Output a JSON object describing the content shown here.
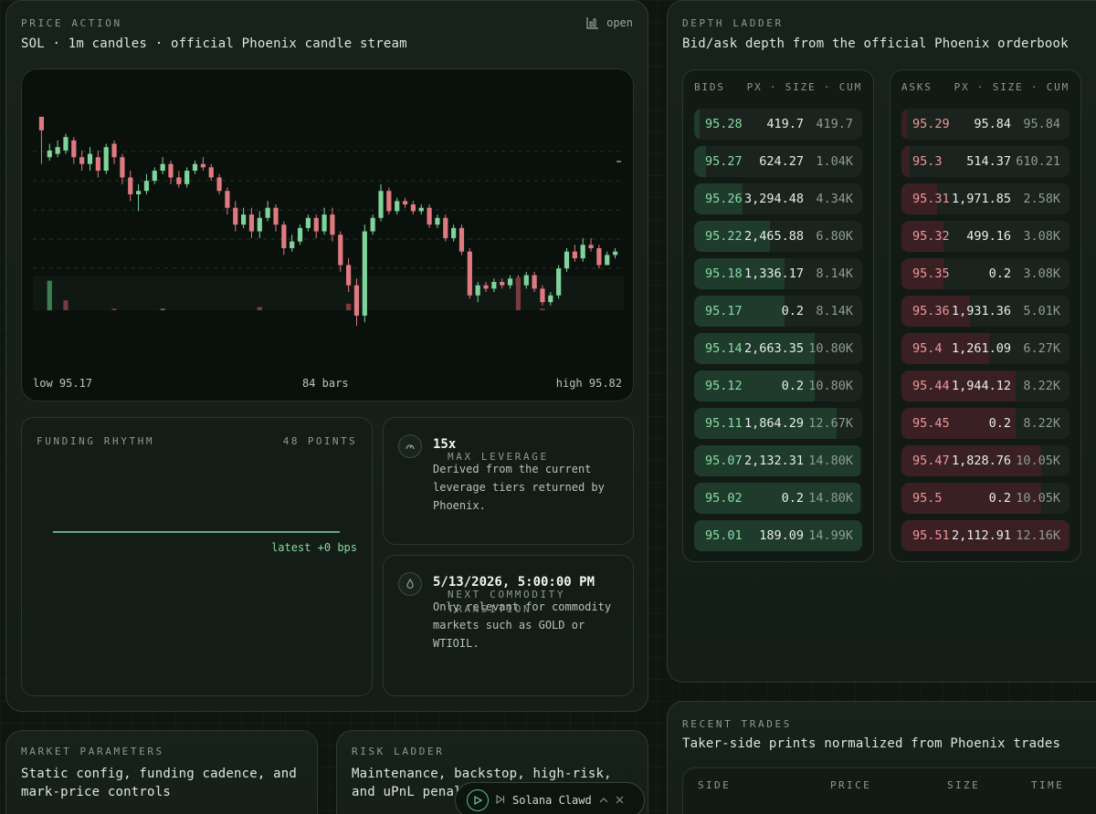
{
  "price_action": {
    "eyebrow": "PRICE ACTION",
    "subtitle": "SOL · 1m candles · official Phoenix candle stream",
    "open_label": "open",
    "low_label": "low 95.17",
    "bars_label": "84 bars",
    "high_label": "high 95.82"
  },
  "chart_data": {
    "type": "candlestick",
    "title": "",
    "ylim": [
      95.17,
      95.82
    ],
    "bars": 84,
    "colors": {
      "up": "#7fd39b",
      "down": "#e07a80",
      "grid": "#24322a"
    },
    "candles": [
      [
        95.82,
        95.78,
        95.82,
        95.68
      ],
      [
        95.7,
        95.72,
        95.74,
        95.69
      ],
      [
        95.71,
        95.73,
        95.75,
        95.7
      ],
      [
        95.72,
        95.76,
        95.77,
        95.71
      ],
      [
        95.75,
        95.7,
        95.76,
        95.68
      ],
      [
        95.7,
        95.68,
        95.72,
        95.66
      ],
      [
        95.68,
        95.71,
        95.73,
        95.66
      ],
      [
        95.7,
        95.66,
        95.72,
        95.64
      ],
      [
        95.66,
        95.73,
        95.74,
        95.65
      ],
      [
        95.74,
        95.7,
        95.75,
        95.68
      ],
      [
        95.7,
        95.64,
        95.71,
        95.62
      ],
      [
        95.64,
        95.59,
        95.66,
        95.57
      ],
      [
        95.59,
        95.6,
        95.62,
        95.54
      ],
      [
        95.6,
        95.63,
        95.65,
        95.59
      ],
      [
        95.63,
        95.66,
        95.67,
        95.62
      ],
      [
        95.66,
        95.68,
        95.7,
        95.65
      ],
      [
        95.68,
        95.64,
        95.69,
        95.62
      ],
      [
        95.64,
        95.62,
        95.66,
        95.61
      ],
      [
        95.62,
        95.66,
        95.67,
        95.61
      ],
      [
        95.66,
        95.68,
        95.69,
        95.65
      ],
      [
        95.68,
        95.67,
        95.7,
        95.66
      ],
      [
        95.67,
        95.64,
        95.68,
        95.63
      ],
      [
        95.64,
        95.6,
        95.65,
        95.59
      ],
      [
        95.6,
        95.55,
        95.61,
        95.53
      ],
      [
        95.55,
        95.5,
        95.57,
        95.48
      ],
      [
        95.5,
        95.53,
        95.55,
        95.49
      ],
      [
        95.53,
        95.48,
        95.55,
        95.46
      ],
      [
        95.48,
        95.52,
        95.54,
        95.46
      ],
      [
        95.52,
        95.55,
        95.57,
        95.51
      ],
      [
        95.55,
        95.5,
        95.56,
        95.48
      ],
      [
        95.5,
        95.43,
        95.51,
        95.41
      ],
      [
        95.43,
        95.45,
        95.47,
        95.42
      ],
      [
        95.45,
        95.49,
        95.5,
        95.44
      ],
      [
        95.49,
        95.52,
        95.53,
        95.48
      ],
      [
        95.52,
        95.48,
        95.53,
        95.46
      ],
      [
        95.48,
        95.53,
        95.55,
        95.47
      ],
      [
        95.53,
        95.47,
        95.55,
        95.45
      ],
      [
        95.47,
        95.38,
        95.48,
        95.36
      ],
      [
        95.38,
        95.32,
        95.4,
        95.3
      ],
      [
        95.32,
        95.23,
        95.34,
        95.2
      ],
      [
        95.23,
        95.48,
        95.5,
        95.21
      ],
      [
        95.48,
        95.52,
        95.53,
        95.47
      ],
      [
        95.52,
        95.6,
        95.62,
        95.51
      ],
      [
        95.6,
        95.54,
        95.61,
        95.53
      ],
      [
        95.54,
        95.57,
        95.58,
        95.53
      ],
      [
        95.57,
        95.56,
        95.58,
        95.55
      ],
      [
        95.56,
        95.54,
        95.57,
        95.53
      ],
      [
        95.54,
        95.55,
        95.56,
        95.53
      ],
      [
        95.55,
        95.5,
        95.56,
        95.49
      ],
      [
        95.5,
        95.52,
        95.53,
        95.49
      ],
      [
        95.52,
        95.46,
        95.53,
        95.45
      ],
      [
        95.46,
        95.49,
        95.5,
        95.45
      ],
      [
        95.49,
        95.42,
        95.5,
        95.41
      ],
      [
        95.42,
        95.29,
        95.43,
        95.28
      ],
      [
        95.29,
        95.32,
        95.33,
        95.27
      ],
      [
        95.32,
        95.31,
        95.33,
        95.3
      ],
      [
        95.31,
        95.33,
        95.34,
        95.3
      ],
      [
        95.33,
        95.32,
        95.34,
        95.31
      ],
      [
        95.32,
        95.34,
        95.35,
        95.31
      ],
      [
        95.34,
        95.32,
        95.35,
        95.31
      ],
      [
        95.32,
        95.35,
        95.36,
        95.31
      ],
      [
        95.35,
        95.31,
        95.36,
        95.3
      ],
      [
        95.31,
        95.27,
        95.32,
        95.26
      ],
      [
        95.27,
        95.29,
        95.3,
        95.26
      ],
      [
        95.29,
        95.37,
        95.38,
        95.28
      ],
      [
        95.37,
        95.42,
        95.43,
        95.36
      ],
      [
        95.42,
        95.4,
        95.44,
        95.39
      ],
      [
        95.4,
        95.44,
        95.46,
        95.39
      ],
      [
        95.44,
        95.43,
        95.46,
        95.42
      ],
      [
        95.43,
        95.38,
        95.44,
        95.37
      ],
      [
        95.38,
        95.41,
        95.42,
        95.38
      ],
      [
        95.41,
        95.42,
        95.43,
        95.4
      ]
    ],
    "volume": [
      [
        1,
        0.9,
        "up"
      ],
      [
        3,
        0.3,
        "down"
      ],
      [
        9,
        0.05,
        "down"
      ],
      [
        15,
        0.05,
        "up"
      ],
      [
        27,
        0.1,
        "down"
      ],
      [
        38,
        0.2,
        "down"
      ],
      [
        59,
        1.0,
        "down"
      ],
      [
        62,
        0.05,
        "down"
      ]
    ]
  },
  "funding": {
    "eyebrow": "FUNDING RHYTHM",
    "points": "48 POINTS",
    "latest": "latest +0 bps"
  },
  "leverage": {
    "eyebrow": "MAX LEVERAGE",
    "value": "15x",
    "desc": "Derived from the current leverage tiers returned by Phoenix."
  },
  "commodity": {
    "eyebrow": "NEXT COMMODITY TRANSITION",
    "value": "5/13/2026, 5:00:00 PM",
    "desc": "Only relevant for commodity markets such as GOLD or WTIOIL."
  },
  "params": {
    "eyebrow": "MARKET PARAMETERS",
    "subtitle": "Static config, funding cadence, and mark-price controls"
  },
  "risk": {
    "eyebrow": "RISK LADDER",
    "subtitle": "Maintenance, backstop, high-risk, and uPnL penalties"
  },
  "depth": {
    "eyebrow": "DEPTH LADDER",
    "subtitle": "Bid/ask depth from the official Phoenix orderbook",
    "bids_head_left": "BIDS",
    "bids_head_right": "PX · SIZE · CUM",
    "asks_head_left": "ASKS",
    "asks_head_right": "PX · SIZE · CUM",
    "bids": [
      {
        "px": "95.28",
        "size": "419.7",
        "cum": "419.7",
        "depth": 0.03
      },
      {
        "px": "95.27",
        "size": "624.27",
        "cum": "1.04K",
        "depth": 0.07
      },
      {
        "px": "95.26",
        "size": "3,294.48",
        "cum": "4.34K",
        "depth": 0.29
      },
      {
        "px": "95.22",
        "size": "2,465.88",
        "cum": "6.80K",
        "depth": 0.45
      },
      {
        "px": "95.18",
        "size": "1,336.17",
        "cum": "8.14K",
        "depth": 0.54
      },
      {
        "px": "95.17",
        "size": "0.2",
        "cum": "8.14K",
        "depth": 0.54
      },
      {
        "px": "95.14",
        "size": "2,663.35",
        "cum": "10.80K",
        "depth": 0.72
      },
      {
        "px": "95.12",
        "size": "0.2",
        "cum": "10.80K",
        "depth": 0.72
      },
      {
        "px": "95.11",
        "size": "1,864.29",
        "cum": "12.67K",
        "depth": 0.85
      },
      {
        "px": "95.07",
        "size": "2,132.31",
        "cum": "14.80K",
        "depth": 0.99
      },
      {
        "px": "95.02",
        "size": "0.2",
        "cum": "14.80K",
        "depth": 0.99
      },
      {
        "px": "95.01",
        "size": "189.09",
        "cum": "14.99K",
        "depth": 1.0
      }
    ],
    "asks": [
      {
        "px": "95.29",
        "size": "95.84",
        "cum": "95.84",
        "depth": 0.01
      },
      {
        "px": "95.3",
        "size": "514.37",
        "cum": "610.21",
        "depth": 0.05
      },
      {
        "px": "95.31",
        "size": "1,971.85",
        "cum": "2.58K",
        "depth": 0.21
      },
      {
        "px": "95.32",
        "size": "499.16",
        "cum": "3.08K",
        "depth": 0.25
      },
      {
        "px": "95.35",
        "size": "0.2",
        "cum": "3.08K",
        "depth": 0.25
      },
      {
        "px": "95.36",
        "size": "1,931.36",
        "cum": "5.01K",
        "depth": 0.41
      },
      {
        "px": "95.4",
        "size": "1,261.09",
        "cum": "6.27K",
        "depth": 0.52
      },
      {
        "px": "95.44",
        "size": "1,944.12",
        "cum": "8.22K",
        "depth": 0.68
      },
      {
        "px": "95.45",
        "size": "0.2",
        "cum": "8.22K",
        "depth": 0.68
      },
      {
        "px": "95.47",
        "size": "1,828.76",
        "cum": "10.05K",
        "depth": 0.83
      },
      {
        "px": "95.5",
        "size": "0.2",
        "cum": "10.05K",
        "depth": 0.83
      },
      {
        "px": "95.51",
        "size": "2,112.91",
        "cum": "12.16K",
        "depth": 1.0
      }
    ]
  },
  "trades": {
    "eyebrow": "RECENT TRADES",
    "subtitle": "Taker-side prints normalized from Phoenix trades",
    "columns": [
      "SIDE",
      "PRICE",
      "SIZE",
      "TIME"
    ]
  },
  "player": {
    "title": "Solana Clawd"
  }
}
